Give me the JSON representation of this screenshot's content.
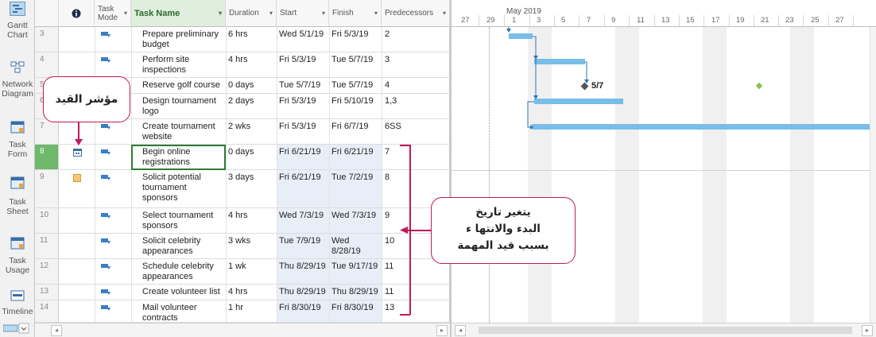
{
  "views": [
    {
      "label": "Gantt Chart",
      "icon": "gantt-chart-icon"
    },
    {
      "label": "Network Diagram",
      "icon": "network-diagram-icon"
    },
    {
      "label": "Task Form",
      "icon": "task-form-icon"
    },
    {
      "label": "Task Sheet",
      "icon": "task-sheet-icon"
    },
    {
      "label": "Task Usage",
      "icon": "task-usage-icon"
    },
    {
      "label": "Timeline",
      "icon": "timeline-icon"
    }
  ],
  "columns": {
    "mode": "Task Mode",
    "name": "Task Name",
    "duration": "Duration",
    "start": "Start",
    "finish": "Finish",
    "predecessors": "Predecessors"
  },
  "tasks": [
    {
      "id": "3",
      "name": "Prepare preliminary budget",
      "duration": "6 hrs",
      "start": "Wed 5/1/19",
      "finish": "Fri 5/3/19",
      "pred": "2"
    },
    {
      "id": "4",
      "name": "Perform site inspections",
      "duration": "4 hrs",
      "start": "Fri 5/3/19",
      "finish": "Tue 5/7/19",
      "pred": "3"
    },
    {
      "id": "5",
      "name": "Reserve golf course",
      "duration": "0 days",
      "start": "Tue 5/7/19",
      "finish": "Tue 5/7/19",
      "pred": "4"
    },
    {
      "id": "6",
      "name": "Design tournament logo",
      "duration": "2 days",
      "start": "Fri 5/3/19",
      "finish": "Fri 5/10/19",
      "pred": "1,3"
    },
    {
      "id": "7",
      "name": "Create tournament website",
      "duration": "2 wks",
      "start": "Fri 5/3/19",
      "finish": "Fri 6/7/19",
      "pred": "6SS"
    },
    {
      "id": "8",
      "name": "Begin online registrations",
      "duration": "0 days",
      "start": "Fri 6/21/19",
      "finish": "Fri 6/21/19",
      "pred": "7"
    },
    {
      "id": "9",
      "name": "Solicit potential tournament sponsors",
      "duration": "3 days",
      "start": "Fri 6/21/19",
      "finish": "Tue 7/2/19",
      "pred": "8"
    },
    {
      "id": "10",
      "name": "Select tournament sponsors",
      "duration": "4 hrs",
      "start": "Wed 7/3/19",
      "finish": "Wed 7/3/19",
      "pred": "9"
    },
    {
      "id": "11",
      "name": "Solicit celebrity appearances",
      "duration": "3 wks",
      "start": "Tue 7/9/19",
      "finish": "Wed 8/28/19",
      "pred": "10"
    },
    {
      "id": "12",
      "name": "Schedule celebrity appearances",
      "duration": "1 wk",
      "start": "Thu 8/29/19",
      "finish": "Tue 9/17/19",
      "pred": "11"
    },
    {
      "id": "13",
      "name": "Create volunteer list",
      "duration": "4 hrs",
      "start": "Thu 8/29/19",
      "finish": "Thu 8/29/19",
      "pred": "11"
    },
    {
      "id": "14",
      "name": "Mail volunteer contracts",
      "duration": "1 hr",
      "start": "Fri 8/30/19",
      "finish": "Fri 8/30/19",
      "pred": "13"
    }
  ],
  "timeline": {
    "month": "May 2019",
    "ticks": [
      "27",
      "29",
      "1",
      "3",
      "5",
      "7",
      "9",
      "11",
      "13",
      "15",
      "17",
      "19",
      "21",
      "23",
      "25",
      "27"
    ]
  },
  "milestone_label": "5/7",
  "callouts": {
    "constraint_indicator": "مؤشر القيد",
    "date_change_line1": "يتغير تاريخ",
    "date_change_line2": "البدء والانتها ء",
    "date_change_line3": "بسبب قيد المهمة"
  },
  "colors": {
    "bar": "#79bde8",
    "accent_green": "#6fb86c",
    "callout_border": "#c2185b"
  }
}
